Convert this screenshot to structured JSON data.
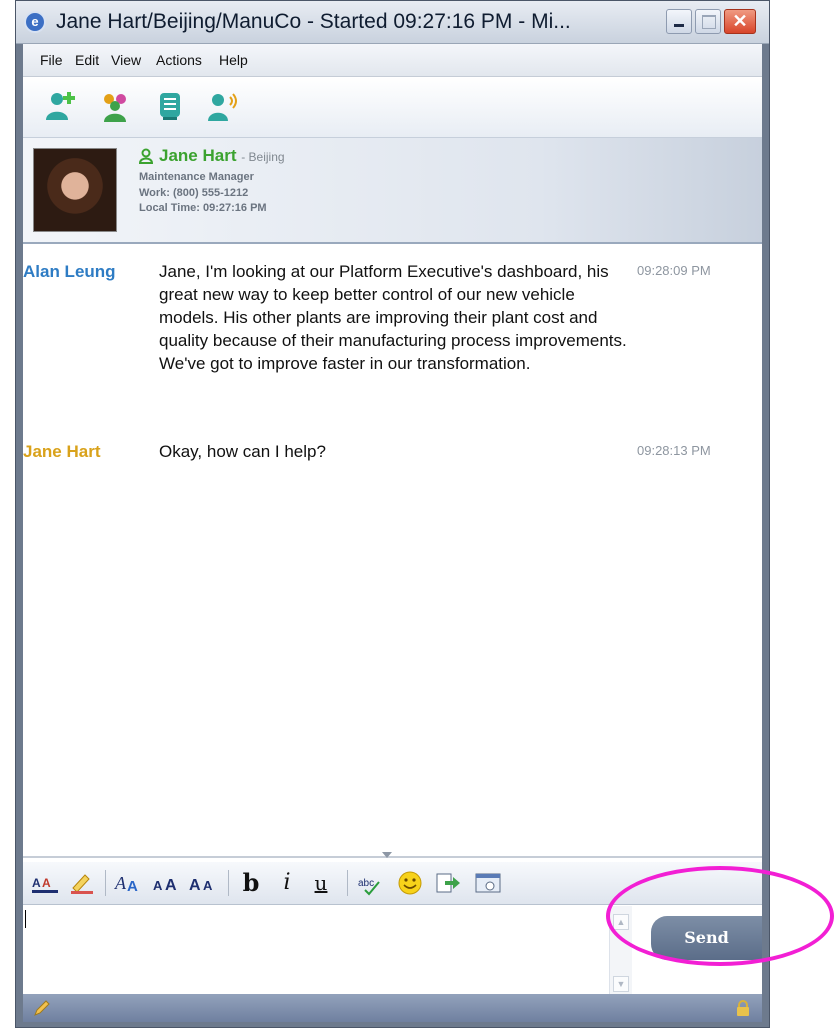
{
  "window": {
    "title": "Jane Hart/Beijing/ManuCo - Started 09:27:16 PM - Mi...",
    "app_icon": "chat-app-icon",
    "controls": [
      "minimize-icon",
      "maximize-icon",
      "close-icon"
    ]
  },
  "menu": {
    "items": [
      "File",
      "Edit",
      "View",
      "Actions",
      "Help"
    ]
  },
  "toolbar": {
    "icons": [
      "add-contact-icon",
      "group-chat-icon",
      "meeting-icon",
      "voice-call-icon"
    ]
  },
  "contact": {
    "name": "Jane Hart",
    "location": "- Beijing",
    "title": "Maintenance Manager",
    "work_phone": "Work: (800) 555-1212",
    "local_time": "Local Time: 09:27:16 PM",
    "status_color": "#3ba22f"
  },
  "messages": [
    {
      "sender": "Alan Leung",
      "sender_color": "#2e7cc4",
      "text": "Jane, I'm looking at our Platform Executive's dashboard, his great new way to keep better control of our new vehicle models.  His other plants are improving their plant cost and quality because of their manufacturing process improvements.   We've got to improve faster in our transformation.",
      "time": "09:28:09 PM"
    },
    {
      "sender": "Jane Hart",
      "sender_color": "#d9a21b",
      "text": "Okay, how can I help?",
      "time": "09:28:13 PM"
    }
  ],
  "format_toolbar": {
    "icons": [
      "text-color-icon",
      "highlight-icon",
      "font-icon",
      "grow-font-icon",
      "shrink-font-icon",
      "bold-icon",
      "italic-icon",
      "underline-icon",
      "spellcheck-icon",
      "emoticon-icon",
      "send-file-icon",
      "screen-capture-icon"
    ],
    "bold": "b",
    "italic": "i",
    "underline": "u"
  },
  "compose": {
    "value": "",
    "send_label": "Send"
  },
  "annotation_color": "#f21fd4"
}
